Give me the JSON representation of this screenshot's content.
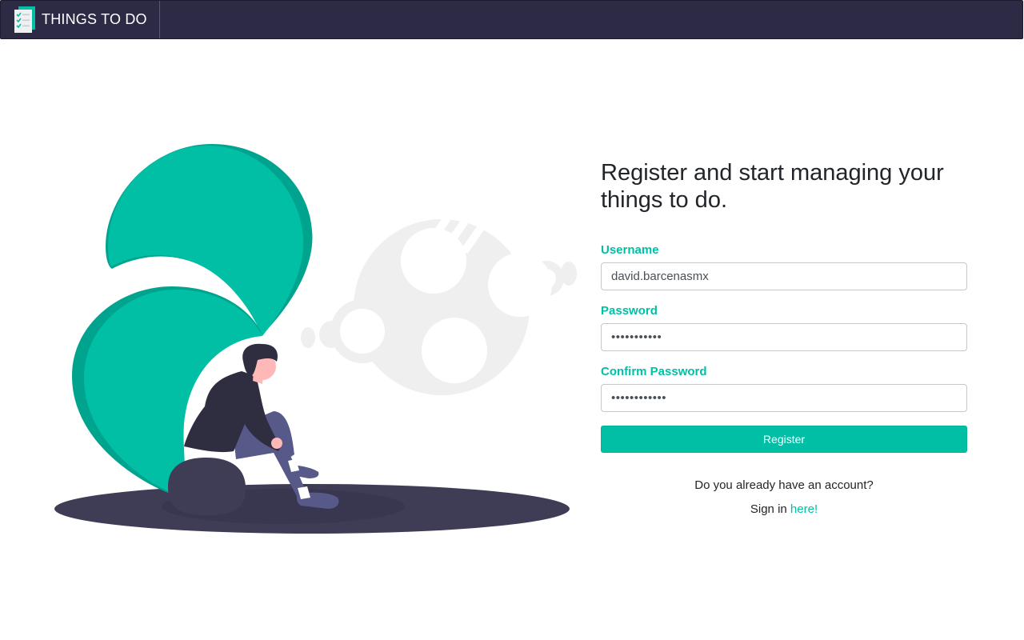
{
  "navbar": {
    "brand_text": "THINGS TO DO",
    "logo_icon": "checklist-document-icon"
  },
  "colors": {
    "primary": "#00bfa5",
    "navbar_bg": "#2d2a45",
    "shadow": "#3f3d56"
  },
  "form": {
    "heading": "Register and start managing your things to do.",
    "username": {
      "label": "Username",
      "value": "david.barcenasmx"
    },
    "password": {
      "label": "Password",
      "value": "•••••••••••"
    },
    "confirm_password": {
      "label": "Confirm Password",
      "value": "••••••••••••"
    },
    "submit_label": "Register",
    "account_question": "Do you already have an account?",
    "signin_prefix": "Sign in ",
    "signin_link": "here!"
  }
}
